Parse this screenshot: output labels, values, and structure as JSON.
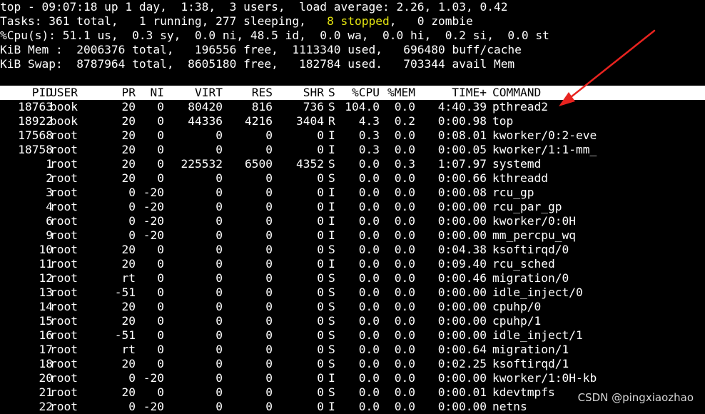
{
  "summary": {
    "line1": "top - 09:07:18 up 1 day,  1:38,  3 users,  load average: 2.26, 1.03, 0.42",
    "tasks_pre": "Tasks: 361 total,   1 running, 277 sleeping,   ",
    "tasks_stopped": "8 stopped",
    "tasks_post": ",   0 zombie",
    "cpu": "%Cpu(s): 51.1 us,  0.3 sy,  0.0 ni, 48.5 id,  0.0 wa,  0.0 hi,  0.2 si,  0.0 st",
    "mem": "KiB Mem :  2006376 total,   196556 free,  1113340 used,   696480 buff/cache",
    "swap": "KiB Swap:  8787964 total,  8605180 free,   182784 used.   703344 avail Mem"
  },
  "table": {
    "headers": [
      "PID",
      "USER",
      "PR",
      "NI",
      "VIRT",
      "RES",
      "SHR",
      "S",
      "%CPU",
      "%MEM",
      "TIME+",
      "COMMAND"
    ],
    "rows": [
      [
        "18763",
        "book",
        "20",
        "0",
        "80420",
        "816",
        "736",
        "S",
        "104.0",
        "0.0",
        "4:40.39",
        "pthread2"
      ],
      [
        "18922",
        "book",
        "20",
        "0",
        "44336",
        "4216",
        "3404",
        "R",
        "4.3",
        "0.2",
        "0:00.98",
        "top"
      ],
      [
        "17568",
        "root",
        "20",
        "0",
        "0",
        "0",
        "0",
        "I",
        "0.3",
        "0.0",
        "0:08.01",
        "kworker/0:2-eve"
      ],
      [
        "18758",
        "root",
        "20",
        "0",
        "0",
        "0",
        "0",
        "I",
        "0.3",
        "0.0",
        "0:00.05",
        "kworker/1:1-mm_"
      ],
      [
        "1",
        "root",
        "20",
        "0",
        "225532",
        "6500",
        "4352",
        "S",
        "0.0",
        "0.3",
        "1:07.97",
        "systemd"
      ],
      [
        "2",
        "root",
        "20",
        "0",
        "0",
        "0",
        "0",
        "S",
        "0.0",
        "0.0",
        "0:00.66",
        "kthreadd"
      ],
      [
        "3",
        "root",
        "0",
        "-20",
        "0",
        "0",
        "0",
        "I",
        "0.0",
        "0.0",
        "0:00.08",
        "rcu_gp"
      ],
      [
        "4",
        "root",
        "0",
        "-20",
        "0",
        "0",
        "0",
        "I",
        "0.0",
        "0.0",
        "0:00.00",
        "rcu_par_gp"
      ],
      [
        "6",
        "root",
        "0",
        "-20",
        "0",
        "0",
        "0",
        "I",
        "0.0",
        "0.0",
        "0:00.00",
        "kworker/0:0H"
      ],
      [
        "9",
        "root",
        "0",
        "-20",
        "0",
        "0",
        "0",
        "I",
        "0.0",
        "0.0",
        "0:00.00",
        "mm_percpu_wq"
      ],
      [
        "10",
        "root",
        "20",
        "0",
        "0",
        "0",
        "0",
        "S",
        "0.0",
        "0.0",
        "0:04.38",
        "ksoftirqd/0"
      ],
      [
        "11",
        "root",
        "20",
        "0",
        "0",
        "0",
        "0",
        "I",
        "0.0",
        "0.0",
        "0:09.40",
        "rcu_sched"
      ],
      [
        "12",
        "root",
        "rt",
        "0",
        "0",
        "0",
        "0",
        "S",
        "0.0",
        "0.0",
        "0:00.46",
        "migration/0"
      ],
      [
        "13",
        "root",
        "-51",
        "0",
        "0",
        "0",
        "0",
        "S",
        "0.0",
        "0.0",
        "0:00.00",
        "idle_inject/0"
      ],
      [
        "14",
        "root",
        "20",
        "0",
        "0",
        "0",
        "0",
        "S",
        "0.0",
        "0.0",
        "0:00.00",
        "cpuhp/0"
      ],
      [
        "15",
        "root",
        "20",
        "0",
        "0",
        "0",
        "0",
        "S",
        "0.0",
        "0.0",
        "0:00.00",
        "cpuhp/1"
      ],
      [
        "16",
        "root",
        "-51",
        "0",
        "0",
        "0",
        "0",
        "S",
        "0.0",
        "0.0",
        "0:00.00",
        "idle_inject/1"
      ],
      [
        "17",
        "root",
        "rt",
        "0",
        "0",
        "0",
        "0",
        "S",
        "0.0",
        "0.0",
        "0:00.64",
        "migration/1"
      ],
      [
        "18",
        "root",
        "20",
        "0",
        "0",
        "0",
        "0",
        "S",
        "0.0",
        "0.0",
        "0:02.25",
        "ksoftirqd/1"
      ],
      [
        "20",
        "root",
        "0",
        "-20",
        "0",
        "0",
        "0",
        "I",
        "0.0",
        "0.0",
        "0:00.00",
        "kworker/1:0H-kb"
      ],
      [
        "21",
        "root",
        "20",
        "0",
        "0",
        "0",
        "0",
        "S",
        "0.0",
        "0.0",
        "0:00.01",
        "kdevtmpfs"
      ],
      [
        "22",
        "root",
        "0",
        "-20",
        "0",
        "0",
        "0",
        "I",
        "0.0",
        "0.0",
        "0:00.00",
        "netns"
      ]
    ]
  },
  "watermark": "CSDN @pingxiaozhao",
  "colors": {
    "background": "#000000",
    "text": "#ffffff",
    "stopped_highlight": "#e5e510",
    "header_bar": "#ffffff",
    "annotation_arrow": "#e8231f"
  },
  "annotation": {
    "icon": "arrow-annotation-icon"
  }
}
